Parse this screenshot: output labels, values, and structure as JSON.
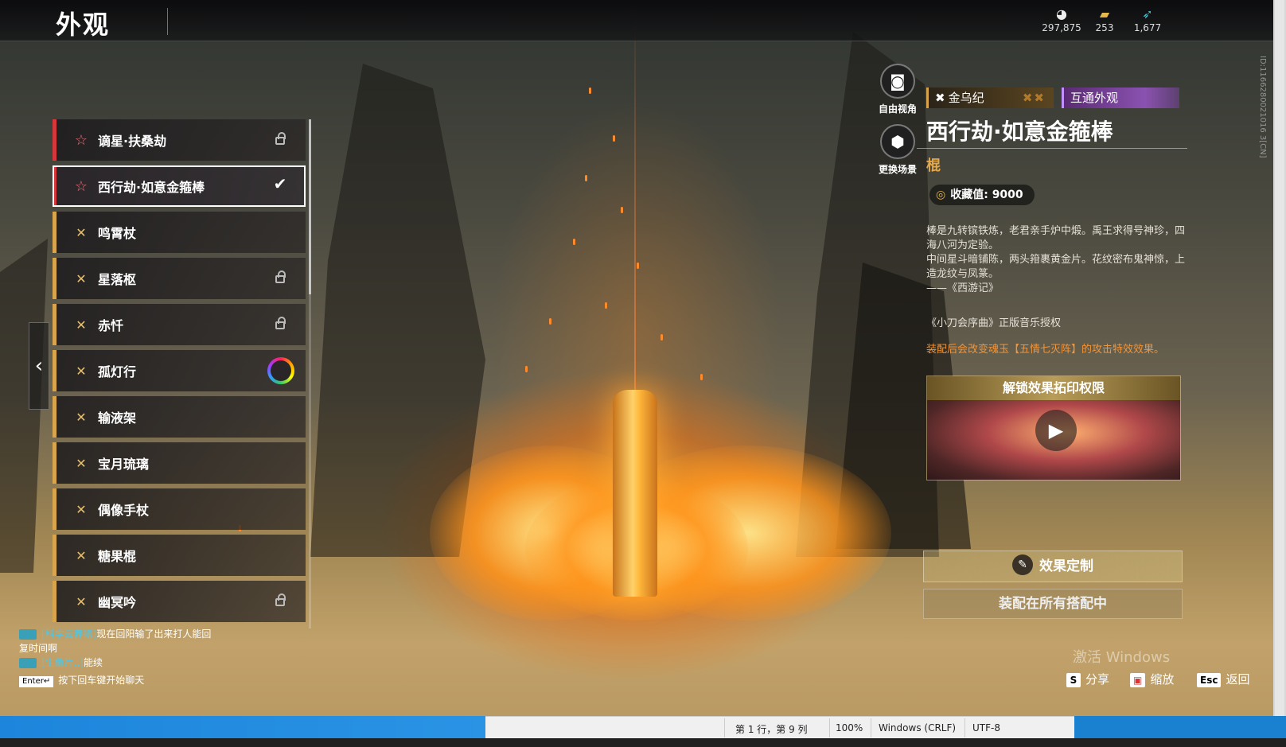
{
  "header": {
    "title": "外观",
    "currencies": [
      {
        "icon": "coin-icon",
        "value": "297,875"
      },
      {
        "icon": "ticket-icon",
        "value": "253"
      },
      {
        "icon": "feather-icon",
        "value": "1,677"
      }
    ]
  },
  "list": {
    "items": [
      {
        "label": "谪星·扶桑劫",
        "mark": "star",
        "status": "lock",
        "accent": "red"
      },
      {
        "label": "西行劫·如意金箍棒",
        "mark": "star",
        "status": "check",
        "accent": "red",
        "selected": true
      },
      {
        "label": "鸣霄杖",
        "mark": "cross",
        "status": "",
        "accent": "gold"
      },
      {
        "label": "星落枢",
        "mark": "cross",
        "status": "lock",
        "accent": "gold"
      },
      {
        "label": "赤忏",
        "mark": "cross",
        "status": "lock",
        "accent": "gold"
      },
      {
        "label": "孤灯行",
        "mark": "cross",
        "status": "ring",
        "accent": "gold"
      },
      {
        "label": "输液架",
        "mark": "cross",
        "status": "",
        "accent": "gold"
      },
      {
        "label": "宝月琉璃",
        "mark": "cross",
        "status": "",
        "accent": "gold"
      },
      {
        "label": "偶像手杖",
        "mark": "cross",
        "status": "",
        "accent": "gold"
      },
      {
        "label": "糖果棍",
        "mark": "cross",
        "status": "",
        "accent": "gold"
      },
      {
        "label": "幽冥吟",
        "mark": "cross",
        "status": "lock",
        "accent": "gold"
      }
    ],
    "collapse_icon": "‹"
  },
  "camera": {
    "free_view": "自由视角",
    "change_scene": "更换场景"
  },
  "detail": {
    "series_tag": "金乌纪",
    "interop_tag": "互通外观",
    "name": "西行劫·如意金箍棒",
    "type": "棍",
    "collect_label": "收藏值: 9000",
    "description": [
      "棒是九转镔铁炼，老君亲手炉中煅。禹王求得号神珍，四海八河为定验。",
      "中间星斗暗铺陈，两头箝裹黄金片。花纹密布鬼神惊，上造龙纹与凤篆。",
      "——《西游记》"
    ],
    "music": "《小刀会序曲》正版音乐授权",
    "effect_note": "装配后会改变魂玉【五情七灭阵】的攻击特效效果。",
    "unlock_title": "解锁效果拓印权限",
    "fx_button": "效果定制",
    "equip_button": "装配在所有搭配中"
  },
  "build_id": "ID:1166280021016 3[CN]",
  "chat": {
    "lines": [
      {
        "who": "[科学云养猪]",
        "text": "现在回阳输了出来打人能回"
      },
      {
        "who": "",
        "text": "复时间啊"
      },
      {
        "who": "[生鱼片..]",
        "text": "能续"
      }
    ],
    "enter_key": "Enter↵",
    "hint": "按下回车键开始聊天"
  },
  "hotkeys": [
    {
      "key": "S",
      "label": "分享"
    },
    {
      "key": "▣",
      "label": "缩放"
    },
    {
      "key": "Esc",
      "label": "返回"
    }
  ],
  "watermark": "激活 Windows",
  "notepad": {
    "position": "第 1 行，第 9 列",
    "zoom": "100%",
    "eol": "Windows (CRLF)",
    "encoding": "UTF-8"
  }
}
